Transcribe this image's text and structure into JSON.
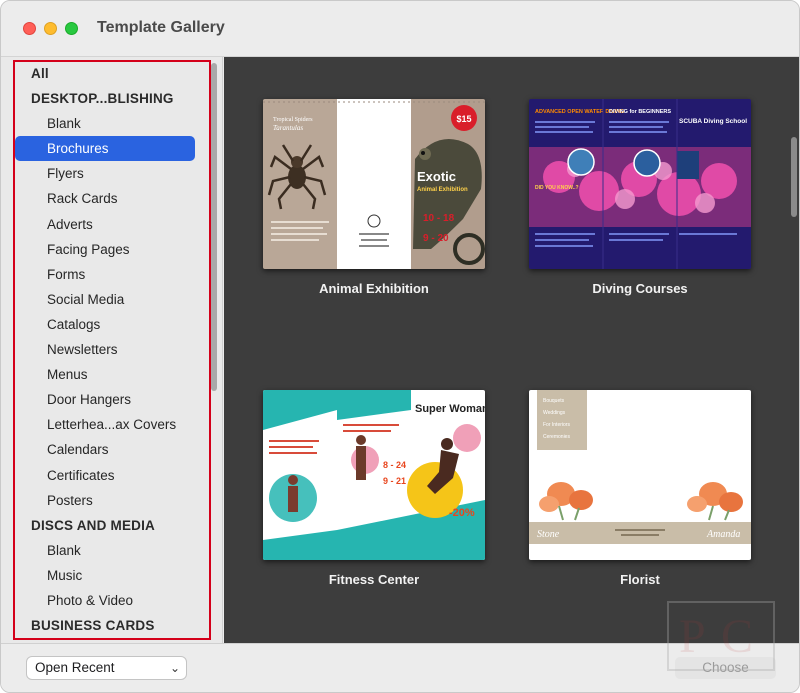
{
  "window": {
    "title": "Template Gallery"
  },
  "sidebar": {
    "rows": [
      {
        "label": "All",
        "kind": "group"
      },
      {
        "label": "DESKTOP...BLISHING",
        "kind": "group"
      },
      {
        "label": "Blank",
        "kind": "item"
      },
      {
        "label": "Brochures",
        "kind": "item",
        "selected": true
      },
      {
        "label": "Flyers",
        "kind": "item"
      },
      {
        "label": "Rack Cards",
        "kind": "item"
      },
      {
        "label": "Adverts",
        "kind": "item"
      },
      {
        "label": "Facing Pages",
        "kind": "item"
      },
      {
        "label": "Forms",
        "kind": "item"
      },
      {
        "label": "Social Media",
        "kind": "item"
      },
      {
        "label": "Catalogs",
        "kind": "item"
      },
      {
        "label": "Newsletters",
        "kind": "item"
      },
      {
        "label": "Menus",
        "kind": "item"
      },
      {
        "label": "Door Hangers",
        "kind": "item"
      },
      {
        "label": "Letterhea...ax Covers",
        "kind": "item"
      },
      {
        "label": "Calendars",
        "kind": "item"
      },
      {
        "label": "Certificates",
        "kind": "item"
      },
      {
        "label": "Posters",
        "kind": "item"
      },
      {
        "label": "DISCS AND MEDIA",
        "kind": "group"
      },
      {
        "label": "Blank",
        "kind": "item"
      },
      {
        "label": "Music",
        "kind": "item"
      },
      {
        "label": "Photo & Video",
        "kind": "item"
      },
      {
        "label": "BUSINESS CARDS",
        "kind": "group"
      }
    ]
  },
  "templates": [
    {
      "name": "Animal Exhibition",
      "thumb": {
        "left_title": "Tropical Spiders",
        "left_subtitle": "Tarantulas",
        "headline": "Exotic",
        "subhead": "Animal Exhibition",
        "badge": "$15",
        "date1": "10 - 18",
        "date2": "9 - 20"
      }
    },
    {
      "name": "Diving Courses",
      "thumb": {
        "col1_title": "ADVANCED OPEN WATER DIVING",
        "col2_title": "DIVING for BEGINNERS",
        "col3_title": "SCUBA Diving School",
        "question": "DID YOU KNOW..?"
      }
    },
    {
      "name": "Fitness Center",
      "thumb": {
        "headline": "Super Woman",
        "discount": "-20%",
        "date1": "8 - 24",
        "date2": "9 - 21"
      }
    },
    {
      "name": "Florist",
      "thumb": {
        "menu": [
          "Bouquets",
          "Weddings",
          "For Interiors",
          "Ceremonies"
        ],
        "left_name": "Stone",
        "right_name": "Amanda"
      }
    }
  ],
  "bottom": {
    "open_recent": "Open Recent",
    "choose": "Choose"
  },
  "colors": {
    "selection": "#2a63e0",
    "highlight_box": "#d4001a",
    "gallery_bg": "#3d3d3d"
  }
}
